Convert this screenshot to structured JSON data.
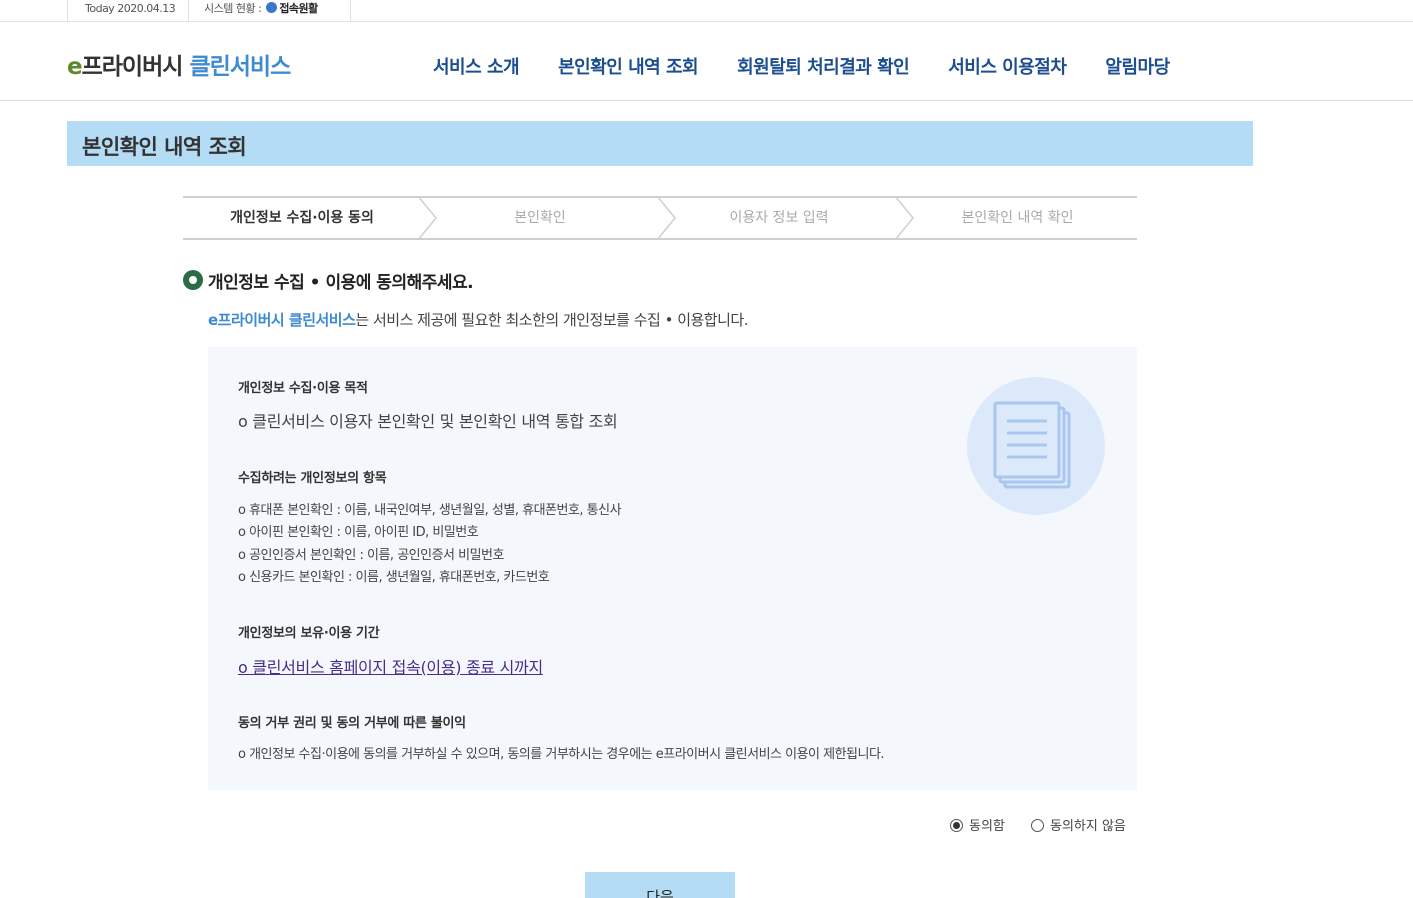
{
  "topbar": {
    "today": "Today 2020.04.13",
    "status_label": "시스템 현황 :",
    "status_value": "접속원활",
    "status_color": "#3a78c9"
  },
  "header": {
    "logo_e": "e",
    "logo_privacy": "프라이버시",
    "logo_clean": "클린서비스",
    "nav": [
      {
        "label": "서비스 소개"
      },
      {
        "label": "본인확인 내역 조회"
      },
      {
        "label": "회원탈퇴 처리결과 확인"
      },
      {
        "label": "서비스 이용절차"
      },
      {
        "label": "알림마당"
      }
    ]
  },
  "page_title": "본인확인 내역 조회",
  "steps": [
    {
      "label": "개인정보 수집·이용 동의",
      "active": true
    },
    {
      "label": "본인확인",
      "active": false
    },
    {
      "label": "이용자 정보 입력",
      "active": false
    },
    {
      "label": "본인확인 내역 확인",
      "active": false
    }
  ],
  "section": {
    "title": "개인정보 수집 • 이용에 동의해주세요.",
    "intro_brand": "e프라이버시 클린서비스",
    "intro_rest": "는 서비스 제공에 필요한 최소한의 개인정보를 수집 • 이용합니다."
  },
  "infobox": {
    "purpose_heading": "개인정보 수집·이용 목적",
    "purpose_text": "o 클린서비스 이용자 본인확인 및 본인확인 내역 통합 조회",
    "items_heading": "수집하려는 개인정보의 항목",
    "items": [
      "o 휴대폰 본인확인 : 이름, 내국인여부, 생년월일, 성별, 휴대폰번호, 통신사",
      "o 아이핀 본인확인 : 이름, 아이핀 ID, 비밀번호",
      "o 공인인증서 본인확인 : 이름, 공인인증서 비밀번호",
      "o 신용카드 본인확인 : 이름, 생년월일, 휴대폰번호, 카드번호"
    ],
    "period_heading": "개인정보의 보유·이용 기간",
    "period_text": "o 클린서비스 홈페이지 접속(이용) 종료 시까지",
    "refusal_heading": "동의 거부 권리 및 동의 거부에 따른 불이익",
    "refusal_text": "o 개인정보 수집·이용에 동의를 거부하실 수 있으며, 동의를 거부하시는 경우에는 e프라이버시 클린서비스 이용이 제한됩니다.",
    "badge_icon": "document-stack-icon"
  },
  "agreement": {
    "agree_label": "동의함",
    "disagree_label": "동의하지 않음",
    "selected": "agree"
  },
  "next_button": "다음",
  "colors": {
    "accent_light_blue": "#b4dcf5",
    "nav_blue": "#1d4e8f",
    "brand_blue": "#3e8bd0",
    "logo_green": "#5b8a2c",
    "section_icon_green": "#2e6a46"
  }
}
